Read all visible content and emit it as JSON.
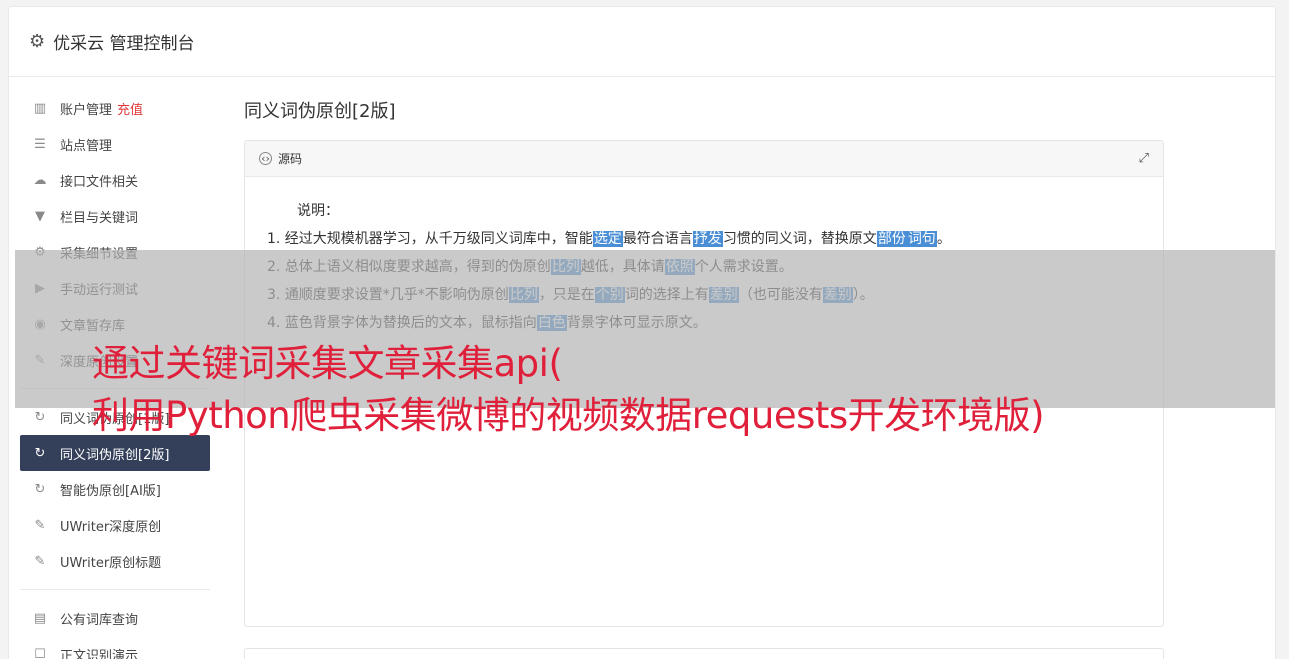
{
  "app": {
    "title": "优采云 管理控制台"
  },
  "sidebar": {
    "items": [
      {
        "label": "账户管理",
        "badge": "充值",
        "icon": "bar-chart-icon",
        "glyph": "▥"
      },
      {
        "label": "站点管理",
        "icon": "server-icon",
        "glyph": "☰"
      },
      {
        "label": "接口文件相关",
        "icon": "cloud-upload-icon",
        "glyph": "☁"
      },
      {
        "label": "栏目与关键词",
        "icon": "filter-icon",
        "glyph": "▼"
      },
      {
        "label": "采集细节设置",
        "icon": "gears-icon",
        "glyph": "⚙"
      },
      {
        "label": "手动运行测试",
        "icon": "play-circle-icon",
        "glyph": "▶"
      },
      {
        "label": "文章暂存库",
        "icon": "database-icon",
        "glyph": "◉"
      },
      {
        "label": "深度原创设置",
        "icon": "edit-icon",
        "glyph": "✎"
      },
      {
        "label": "同义词伪原创[1版]",
        "icon": "refresh-icon",
        "glyph": "↻"
      },
      {
        "label": "同义词伪原创[2版]",
        "icon": "refresh-icon",
        "glyph": "↻"
      },
      {
        "label": "智能伪原创[AI版]",
        "icon": "refresh-icon",
        "glyph": "↻"
      },
      {
        "label": "UWriter深度原创",
        "icon": "edit-icon",
        "glyph": "✎"
      },
      {
        "label": "UWriter原创标题",
        "icon": "edit-icon",
        "glyph": "✎"
      },
      {
        "label": "公有词库查询",
        "icon": "book-icon",
        "glyph": "▤"
      },
      {
        "label": "正文识别演示",
        "icon": "square-icon",
        "glyph": "☐"
      }
    ]
  },
  "main": {
    "title": "同义词伪原创[2版]",
    "panel": {
      "header": "源码",
      "explain_label": "说明：",
      "lines": [
        [
          "1. 经过大规模机器学习，从千万级同义词库中，智能",
          {
            "h": "选定"
          },
          "最符合语言",
          {
            "h": "抒发"
          },
          "习惯的同义词，替换原文",
          {
            "h": "部份"
          },
          {
            "h": "词句"
          },
          "。"
        ],
        [
          "2. 总体上语义相似度要求越高，得到的伪原创",
          {
            "h": "比列"
          },
          "越低，具体请",
          {
            "h": "依照"
          },
          "个人需求设置。"
        ],
        [
          "3. 通顺度要求设置*几乎*不影响伪原创",
          {
            "h": "比列"
          },
          "，只是在",
          {
            "h": "个别"
          },
          "词的选择上有",
          {
            "h": "差别"
          },
          "（也可能没有",
          {
            "h": "差别"
          },
          "）。"
        ],
        [
          "4. 蓝色背景字体为替换后的文本，鼠标指向",
          {
            "h": "白色"
          },
          "背景字体可显示原文。"
        ]
      ]
    }
  },
  "overlay": {
    "line1": "通过关键词采集文章采集api(",
    "line2": "利用Python爬虫采集微博的视频数据requests开发环境版)"
  },
  "colors": {
    "active_nav": "#34405a",
    "highlight": "#4a8fd6",
    "overlay_text": "#e0203a",
    "charge": "#e03a3a"
  }
}
